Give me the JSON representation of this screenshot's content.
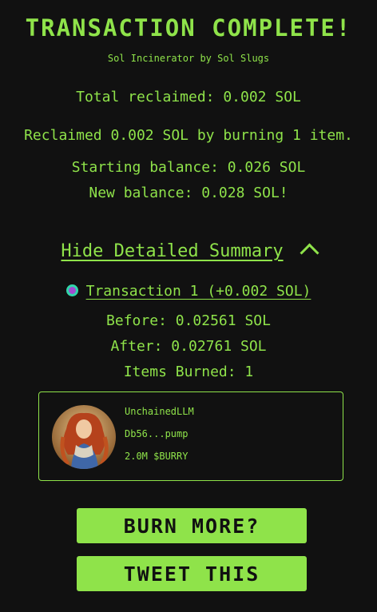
{
  "header": {
    "title": "TRANSACTION COMPLETE!",
    "subtitle": "Sol Incinerator by Sol Slugs"
  },
  "summary": {
    "total": "Total reclaimed: 0.002 SOL",
    "reclaimed": "Reclaimed 0.002 SOL by burning 1 item.",
    "starting": "Starting balance: 0.026 SOL",
    "new_balance": "New balance: 0.028 SOL!"
  },
  "details_toggle": {
    "label": "Hide Detailed Summary",
    "icon": "chevron-up-icon"
  },
  "transaction": {
    "label": "Transaction 1 (+0.002 SOL)",
    "before": "Before: 0.02561 SOL",
    "after": "After: 0.02761 SOL",
    "items_burned": "Items Burned: 1"
  },
  "item": {
    "name": "UnchainedLLM",
    "address": "Db56...pump",
    "amount": "2.0M $BURRY"
  },
  "buttons": {
    "burn_more": "BURN MORE?",
    "tweet": "TWEET THIS"
  },
  "colors": {
    "accent": "#8fe34a",
    "background": "#111111",
    "status_dot_ring": "#31d6a9",
    "status_dot_fill": "#a14bd1"
  }
}
